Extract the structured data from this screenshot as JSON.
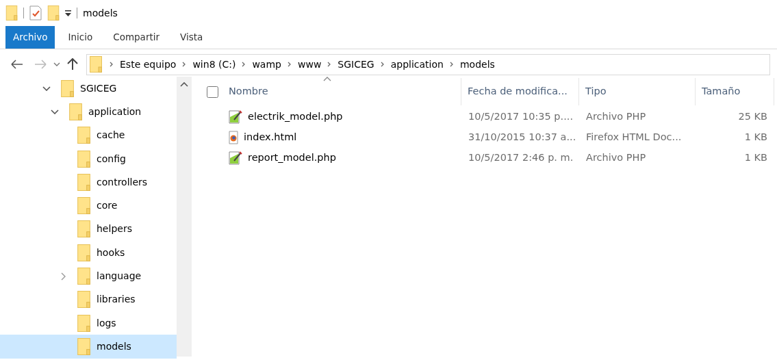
{
  "window": {
    "title": "models"
  },
  "ribbon_tabs": [
    {
      "label": "Archivo",
      "selected": true
    },
    {
      "label": "Inicio",
      "selected": false
    },
    {
      "label": "Compartir",
      "selected": false
    },
    {
      "label": "Vista",
      "selected": false
    }
  ],
  "address_bar": {
    "path": [
      "Este equipo",
      "win8 (C:)",
      "wamp",
      "www",
      "SGICEG",
      "application",
      "models"
    ]
  },
  "nav_tree": [
    {
      "label": "SGICEG",
      "expanded": true,
      "selected": false,
      "children": [
        {
          "label": "application",
          "expanded": true,
          "selected": false,
          "children": [
            {
              "label": "cache",
              "selected": false
            },
            {
              "label": "config",
              "selected": false
            },
            {
              "label": "controllers",
              "selected": false
            },
            {
              "label": "core",
              "selected": false
            },
            {
              "label": "helpers",
              "selected": false
            },
            {
              "label": "hooks",
              "selected": false
            },
            {
              "label": "language",
              "expanded": false,
              "selected": false
            },
            {
              "label": "libraries",
              "selected": false
            },
            {
              "label": "logs",
              "selected": false
            },
            {
              "label": "models",
              "selected": true
            }
          ]
        }
      ]
    }
  ],
  "file_list": {
    "select_all_checked": false,
    "columns": [
      "Nombre",
      "Fecha de modifica...",
      "Tipo",
      "Tamaño"
    ],
    "rows": [
      {
        "kind": "php",
        "name": "electrik_model.php",
        "date": "10/5/2017 10:35 p....",
        "type": "Archivo PHP",
        "size": "25 KB"
      },
      {
        "kind": "html",
        "name": "index.html",
        "date": "31/10/2015 10:37 a...",
        "type": "Firefox HTML Doc...",
        "size": "1 KB"
      },
      {
        "kind": "php",
        "name": "report_model.php",
        "date": "10/5/2017 2:46 p. m.",
        "type": "Archivo PHP",
        "size": "1 KB"
      }
    ]
  }
}
